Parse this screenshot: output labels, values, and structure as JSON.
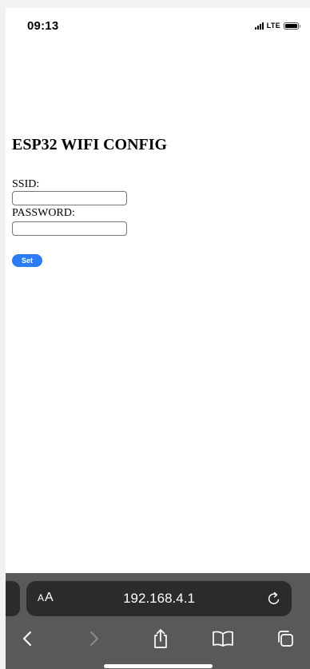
{
  "status_bar": {
    "time": "09:13",
    "network": "LTE"
  },
  "page": {
    "title": "ESP32 WIFI CONFIG",
    "ssid_label": "SSID:",
    "ssid_value": "",
    "password_label": "PASSWORD:",
    "password_value": "",
    "set_button": "Set"
  },
  "browser": {
    "text_size_button": {
      "small": "A",
      "large": "A"
    },
    "url": "192.168.4.1",
    "toolbar": [
      "back-icon",
      "forward-icon",
      "share-icon",
      "bookmarks-icon",
      "tabs-icon"
    ]
  },
  "colors": {
    "button_blue": "#2c7cf6",
    "browser_bar": "#595959",
    "address_field": "#2b2b2b"
  }
}
